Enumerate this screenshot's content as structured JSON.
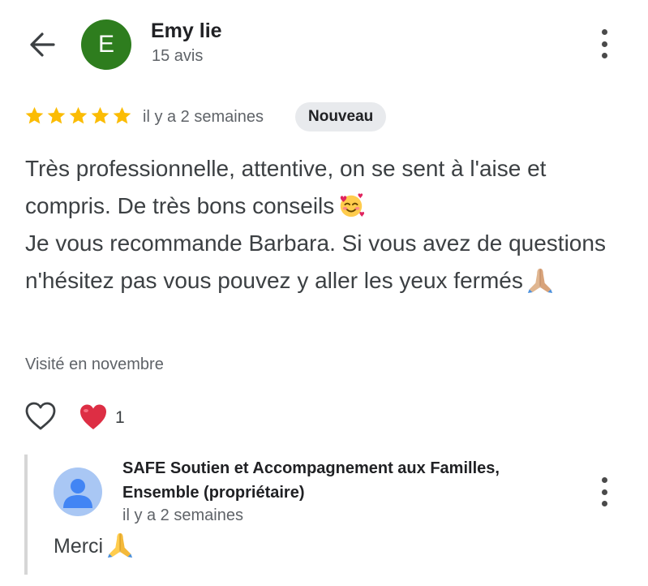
{
  "header": {
    "back_icon": "arrow-left-icon",
    "avatar_letter": "E",
    "avatar_color": "#2e7d1e",
    "reviewer_name": "Emy lie",
    "review_count": "15 avis",
    "menu_icon": "more-vertical-icon"
  },
  "rating": {
    "stars": 5,
    "star_color": "#fbbc04",
    "date": "il y a 2 semaines",
    "badge": "Nouveau"
  },
  "review": {
    "line1": "Très professionnelle, attentive, on se sent à l'aise et compris. De très bons conseils",
    "line1_emoji": "smiling-face-with-hearts-icon",
    "line2": "Je vous recommande Barbara. Si vous avez de questions n'hésitez pas vous pouvez y aller les yeux fermés",
    "line2_emoji": "folded-hands-icon",
    "visited": "Visité en novembre"
  },
  "reactions": {
    "like_icon": "heart-outline-icon",
    "heart_icon": "red-heart-icon",
    "count": "1"
  },
  "owner_reply": {
    "name": "SAFE Soutien et Accompagnement aux Familles, Ensemble (propriétaire)",
    "date": "il y a 2 semaines",
    "text": "Merci",
    "text_emoji": "folded-hands-icon",
    "menu_icon": "more-vertical-icon"
  }
}
